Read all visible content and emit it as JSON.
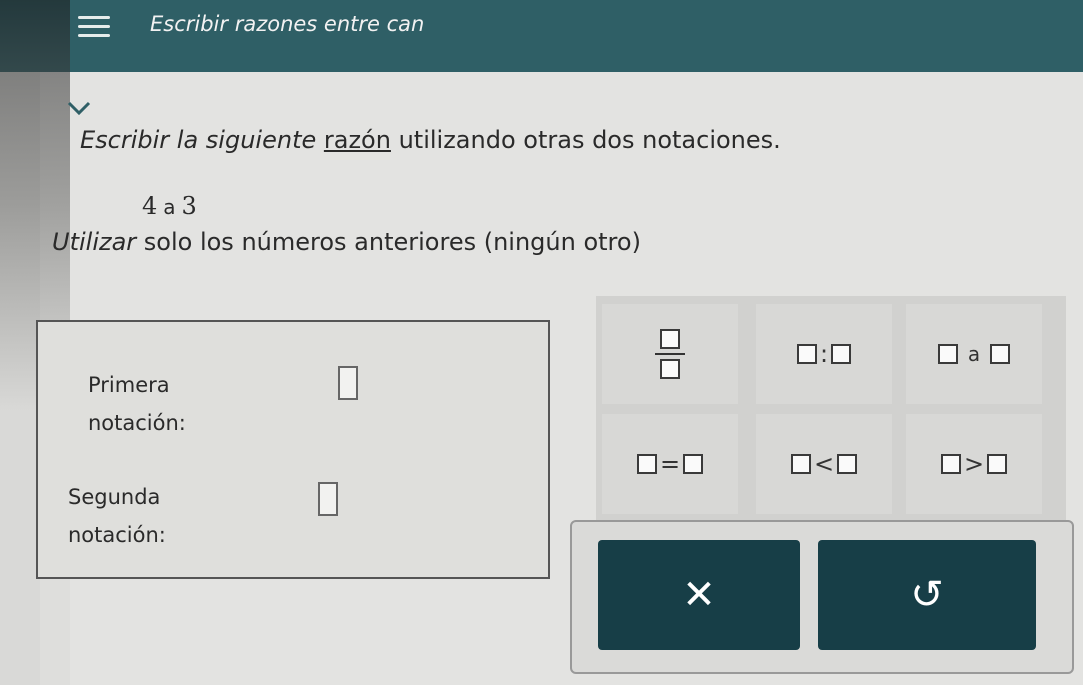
{
  "header": {
    "title": "Escribir razones entre can"
  },
  "question": {
    "instruction_part1": "Escribir la siguiente ",
    "instruction_link": "razón",
    "instruction_part2": " utilizando otras dos notaciones.",
    "ratio_left": "4",
    "ratio_word": "a",
    "ratio_right": "3",
    "rule_part1": "Utilizar",
    "rule_part2": " solo los números anteriores (ningún otro)"
  },
  "answer": {
    "first_label_line1": "Primera",
    "first_label_line2": "notación:",
    "second_label_line1": "Segunda",
    "second_label_line2": "notación:"
  },
  "palette": {
    "colon_op": ":",
    "a_word": "a",
    "eq_op": "=",
    "lt_op": "<",
    "gt_op": ">"
  },
  "actions": {
    "clear_symbol": "✕",
    "undo_symbol": "↺"
  },
  "colors": {
    "header": "#2f5f66",
    "button": "#173e47"
  }
}
